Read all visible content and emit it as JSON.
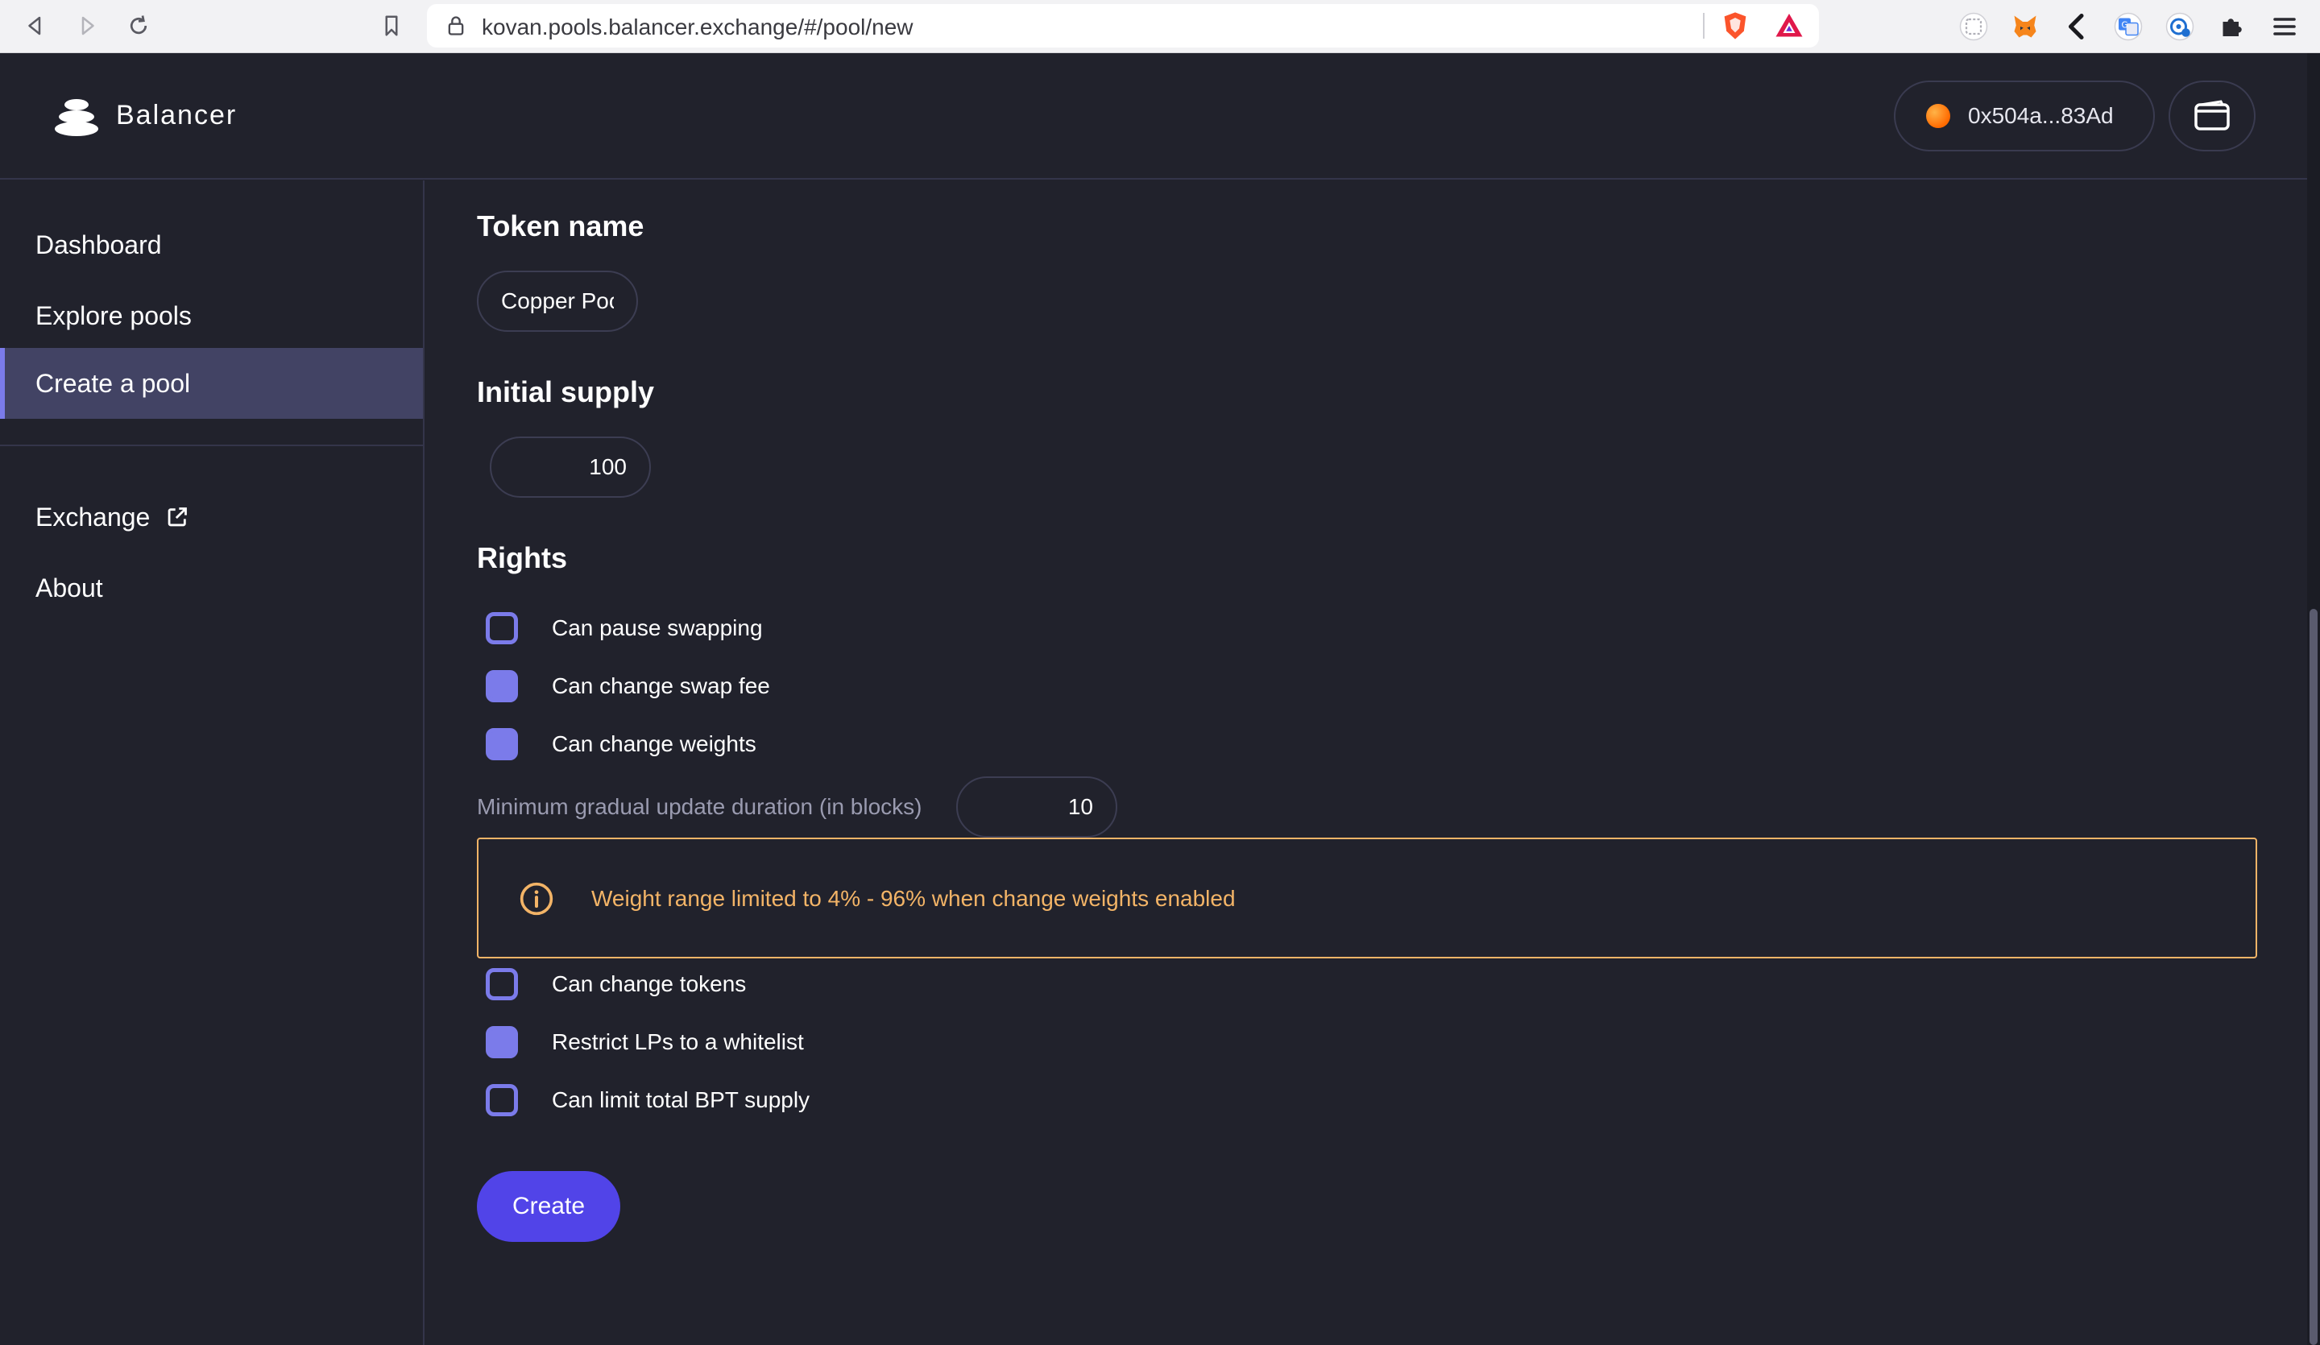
{
  "browser": {
    "url": "kovan.pools.balancer.exchange/#/pool/new",
    "icons": [
      "back-icon",
      "forward-icon",
      "reload-icon",
      "bookmark-icon",
      "lock-icon",
      "brave-shield-icon",
      "brave-rewards-icon",
      "extension-icon",
      "metamask-icon",
      "chevron-left-icon",
      "translate-icon",
      "password-manager-icon",
      "puzzle-icon",
      "menu-icon"
    ]
  },
  "header": {
    "brand": "Balancer",
    "account": "0x504a...83Ad"
  },
  "sidebar": {
    "items": [
      {
        "label": "Dashboard"
      },
      {
        "label": "Explore pools"
      },
      {
        "label": "Create a pool",
        "active": true
      },
      {
        "label": "Exchange",
        "external": true
      },
      {
        "label": "About"
      }
    ]
  },
  "form": {
    "token_name": {
      "title": "Token name",
      "value": "Copper Pool"
    },
    "initial_supply": {
      "title": "Initial supply",
      "value": "100"
    },
    "rights": {
      "title": "Rights",
      "options": [
        {
          "label": "Can pause swapping",
          "checked": false
        },
        {
          "label": "Can change swap fee",
          "checked": true
        },
        {
          "label": "Can change weights",
          "checked": true
        },
        {
          "label": "Can change tokens",
          "checked": false
        },
        {
          "label": "Restrict LPs to a whitelist",
          "checked": true
        },
        {
          "label": "Can limit total BPT supply",
          "checked": false
        }
      ],
      "duration_label": "Minimum gradual update duration (in blocks)",
      "duration_value": "10",
      "warning": "Weight range limited to 4% - 96% when change weights enabled"
    },
    "submit_label": "Create"
  },
  "colors": {
    "background": "#21222c",
    "accent": "#7b7bea",
    "primary_button": "#5144e8",
    "warning": "#f3b467",
    "active_nav": "#424364"
  }
}
